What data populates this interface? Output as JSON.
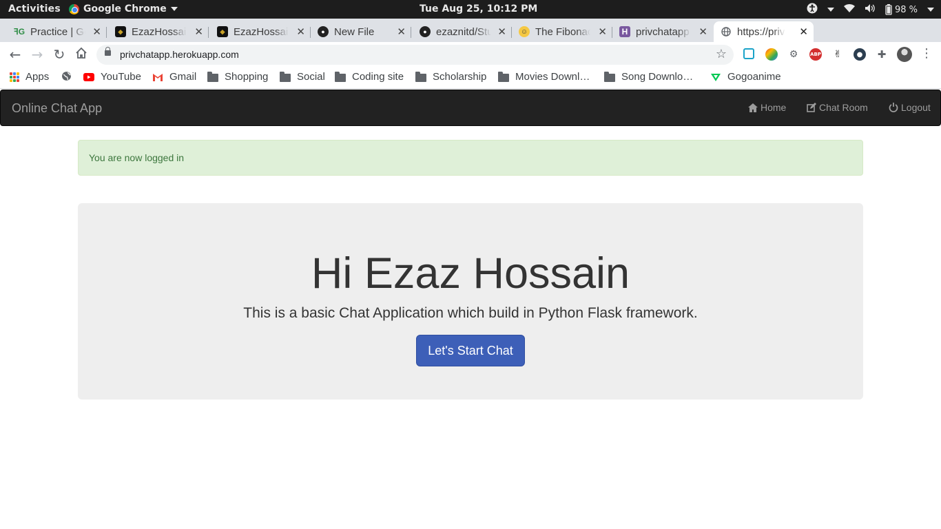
{
  "system_bar": {
    "activities": "Activities",
    "app_name": "Google Chrome",
    "clock": "Tue Aug 25, 10:12 PM",
    "battery": "98 %"
  },
  "tabs": [
    {
      "label": "Practice | GeeksforGeeks",
      "favicon": "GG",
      "active": false
    },
    {
      "label": "EzazHossain",
      "favicon": "E",
      "active": false
    },
    {
      "label": "EzazHossain",
      "favicon": "E",
      "active": false
    },
    {
      "label": "New File",
      "favicon": "github",
      "active": false
    },
    {
      "label": "ezaznitd/StudyMaterial",
      "favicon": "github",
      "active": false
    },
    {
      "label": "The Fibonacci",
      "favicon": "face",
      "active": false
    },
    {
      "label": "privchatapp",
      "favicon": "H",
      "active": false
    },
    {
      "label": "https://privchatapp.herokuapp.com",
      "favicon": "globe",
      "active": true
    }
  ],
  "omnibox": {
    "url": "privchatapp.herokuapp.com"
  },
  "bookmarks": [
    {
      "label": "Apps",
      "icon": "apps-grid-icon"
    },
    {
      "label": "",
      "icon": "globe-icon"
    },
    {
      "label": "YouTube",
      "icon": "youtube-icon"
    },
    {
      "label": "Gmail",
      "icon": "gmail-icon"
    },
    {
      "label": "Shopping",
      "icon": "folder-icon"
    },
    {
      "label": "Social",
      "icon": "folder-icon"
    },
    {
      "label": "Coding site",
      "icon": "folder-icon"
    },
    {
      "label": "Scholarship",
      "icon": "folder-icon"
    },
    {
      "label": "Movies Downl…",
      "icon": "folder-icon"
    },
    {
      "label": "Song Downlo…",
      "icon": "folder-icon"
    },
    {
      "label": "Gogoanime",
      "icon": "gogoanime-icon"
    }
  ],
  "app": {
    "brand": "Online Chat App",
    "nav": {
      "home": "Home",
      "chat_room": "Chat Room",
      "logout": "Logout"
    },
    "alert": "You are now logged in",
    "greeting": "Hi Ezaz Hossain",
    "description": "This is a basic Chat Application which build in Python Flask framework.",
    "cta": "Let's Start Chat"
  },
  "colors": {
    "navbar_bg": "#222222",
    "alert_bg": "#dff0d8",
    "alert_text": "#3c763d",
    "jumbotron_bg": "#eeeeee",
    "button_primary": "#3d5fb8"
  }
}
